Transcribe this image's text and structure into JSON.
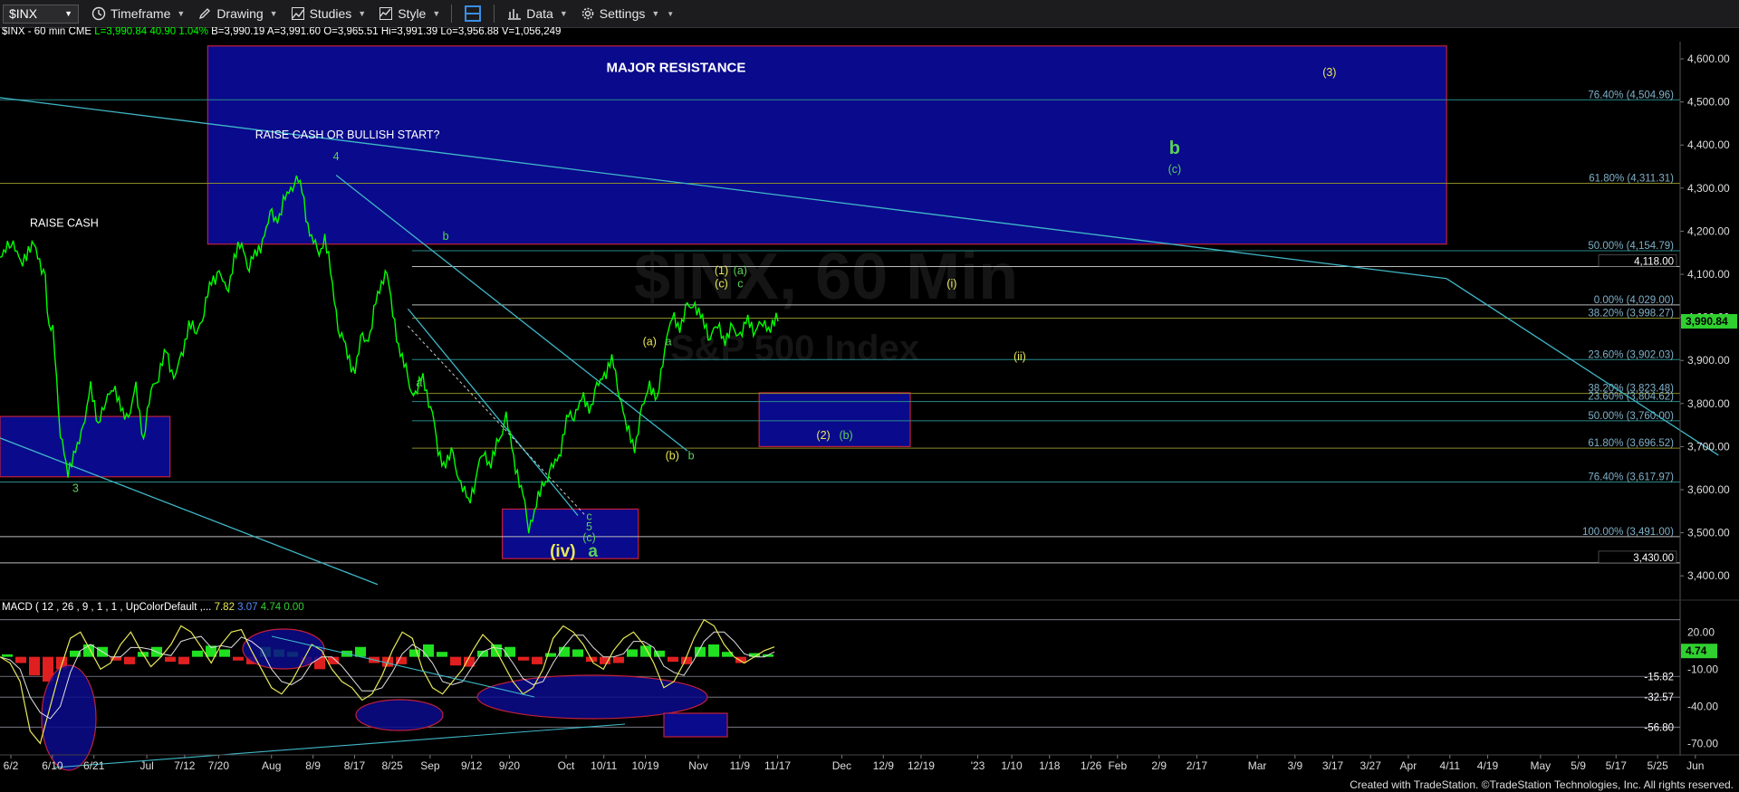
{
  "toolbar": {
    "symbol": "$INX",
    "timeframe": "Timeframe",
    "drawing": "Drawing",
    "studies": "Studies",
    "style": "Style",
    "data": "Data",
    "settings": "Settings"
  },
  "header": {
    "symbol_interval": "$INX - 60 min",
    "exchange": "CME",
    "last": "L=3,990.84",
    "change": "40.90",
    "pct": "1.04%",
    "bid": "B=3,990.19",
    "ask": "A=3,991.60",
    "open": "O=3,965.51",
    "high": "Hi=3,991.39",
    "low": "Lo=3,956.88",
    "volume": "V=1,056,249"
  },
  "watermark": {
    "line1": "$INX, 60 Min",
    "line2": "S&P 500 Index"
  },
  "footer": "Created with TradeStation. ©TradeStation Technologies, Inc. All rights reserved.",
  "colors": {
    "price": "#00ff00",
    "trend": "#3fb8c8",
    "zone": "#0a0a8c",
    "zone_border": "#c0203a",
    "wave_yellow": "#e8e85a",
    "wave_green": "#5ad05a"
  },
  "chart_data": {
    "type": "line",
    "instrument": "$INX",
    "price_axis": {
      "ylim": [
        3350,
        4640
      ],
      "ticks": [
        "4,600.00",
        "4,500.00",
        "4,400.00",
        "4,300.00",
        "4,200.00",
        "4,100.00",
        "4,000.00",
        "3,900.00",
        "3,800.00",
        "3,700.00",
        "3,600.00",
        "3,500.00",
        "3,400.00"
      ],
      "tick_values": [
        4600,
        4500,
        4400,
        4300,
        4200,
        4100,
        4000,
        3900,
        3800,
        3700,
        3600,
        3500,
        3400
      ],
      "last_price_label": "3,990.84",
      "last_price": 3990.84
    },
    "x_axis": {
      "labels": [
        "6/2",
        "6/10",
        "6/21",
        "Jul",
        "7/12",
        "7/20",
        "Aug",
        "8/9",
        "8/17",
        "8/25",
        "Sep",
        "9/12",
        "9/20",
        "Oct",
        "10/11",
        "10/19",
        "Nov",
        "11/9",
        "11/17",
        "Dec",
        "12/9",
        "12/19",
        "'23",
        "1/10",
        "1/18",
        "1/26",
        "Feb",
        "2/9",
        "2/17",
        "Mar",
        "3/9",
        "3/17",
        "3/27",
        "Apr",
        "4/11",
        "4/19",
        "May",
        "5/9",
        "5/17",
        "5/25",
        "Jun"
      ],
      "positions": [
        0,
        11,
        22,
        36,
        46,
        55,
        69,
        80,
        91,
        101,
        111,
        122,
        132,
        147,
        157,
        168,
        182,
        193,
        203,
        220,
        231,
        241,
        256,
        265,
        275,
        286,
        293,
        304,
        314,
        330,
        340,
        350,
        360,
        370,
        381,
        391,
        405,
        415,
        425,
        436,
        446
      ]
    },
    "price_series": {
      "name": "$INX",
      "x": [
        0,
        3,
        6,
        9,
        12,
        13,
        14,
        16,
        18,
        20,
        22,
        24,
        26,
        28,
        30,
        32,
        34,
        36,
        38,
        40,
        42,
        44,
        46,
        48,
        50,
        52,
        54,
        56,
        58,
        60,
        62,
        64,
        66,
        68,
        70,
        72,
        74,
        76,
        78,
        80,
        82,
        84,
        86,
        88,
        90,
        92,
        94,
        96,
        98,
        100,
        102,
        104,
        106,
        108,
        110,
        112,
        114,
        116,
        118,
        120,
        122,
        124,
        126,
        128,
        130,
        132,
        134,
        136,
        138,
        140,
        142,
        144,
        146,
        148,
        150,
        152,
        154,
        156,
        158,
        160,
        162,
        164,
        166,
        168,
        170,
        172,
        174,
        176,
        178,
        180,
        182,
        184,
        186,
        188,
        190,
        192,
        194,
        196,
        198,
        200,
        202,
        204,
        206
      ],
      "y": [
        4150,
        4165,
        4140,
        4160,
        4100,
        3960,
        3990,
        3720,
        3650,
        3680,
        3750,
        3830,
        3760,
        3800,
        3850,
        3780,
        3770,
        3830,
        3720,
        3830,
        3870,
        3920,
        3860,
        3900,
        3990,
        3960,
        4020,
        4080,
        4110,
        4050,
        4140,
        4170,
        4120,
        4150,
        4190,
        4240,
        4230,
        4290,
        4320,
        4300,
        4190,
        4150,
        4180,
        4080,
        3960,
        3920,
        3870,
        3960,
        3950,
        4060,
        4110,
        4020,
        3910,
        3860,
        3810,
        3870,
        3790,
        3700,
        3650,
        3690,
        3600,
        3580,
        3620,
        3700,
        3650,
        3720,
        3760,
        3680,
        3600,
        3520,
        3560,
        3620,
        3640,
        3680,
        3760,
        3780,
        3810,
        3790,
        3830,
        3870,
        3900,
        3830,
        3740,
        3700,
        3780,
        3850,
        3800,
        3940,
        4000,
        3980,
        4020,
        4030,
        3990,
        3960,
        3980,
        3950,
        3970,
        3960,
        3990,
        3975,
        3985,
        3980,
        3990.84
      ]
    },
    "fib_levels": [
      {
        "label": "76.40% (4,504.96)",
        "value": 4504.96
      },
      {
        "label": "61.80% (4,311.31)",
        "value": 4311.31
      },
      {
        "label": "50.00% (4,154.79)",
        "value": 4154.79
      },
      {
        "label": "4,118.00",
        "value": 4118.0
      },
      {
        "label": "0.00% (4,029.00)",
        "value": 4029.0
      },
      {
        "label": "38.20% (3,998.27)",
        "value": 3998.27
      },
      {
        "label": "23.60% (3,902.03)",
        "value": 3902.03
      },
      {
        "label": "38.20% (3,823.48)",
        "value": 3823.48
      },
      {
        "label": "23.60% (3,804.62)",
        "value": 3804.62
      },
      {
        "label": "50.00% (3,760.00)",
        "value": 3760.0
      },
      {
        "label": "61.80% (3,696.52)",
        "value": 3696.52
      },
      {
        "label": "76.40% (3,617.97)",
        "value": 3617.97
      },
      {
        "label": "100.00% (3,491.00)",
        "value": 3491.0
      },
      {
        "label": "3,430.00",
        "value": 3430.0
      }
    ],
    "zones": [
      {
        "name": "MAJOR RESISTANCE",
        "x": [
          55,
          383
        ],
        "y": [
          4170,
          4630
        ]
      },
      {
        "name": "left-support",
        "x": [
          0,
          45
        ],
        "y": [
          3630,
          3770
        ]
      },
      {
        "name": "c-target",
        "x": [
          133,
          169
        ],
        "y": [
          3440,
          3555
        ]
      },
      {
        "name": "(2)-target",
        "x": [
          201,
          241
        ],
        "y": [
          3700,
          3825
        ]
      }
    ],
    "trendlines": [
      {
        "x": [
          0,
          383
        ],
        "y": [
          4510,
          4090
        ]
      },
      {
        "x": [
          0,
          100
        ],
        "y": [
          3720,
          3380
        ]
      },
      {
        "x": [
          89,
          182
        ],
        "y": [
          4330,
          3690
        ]
      },
      {
        "x": [
          108,
          153
        ],
        "y": [
          4020,
          3540
        ]
      },
      {
        "x": [
          383,
          455
        ],
        "y": [
          4090,
          3680
        ]
      }
    ],
    "annotations": [
      {
        "text": "MAJOR RESISTANCE",
        "x": 179,
        "y": 4570
      },
      {
        "text": "RAISE CASH OR BULLISH START?",
        "x": 92,
        "y": 4415
      },
      {
        "text": "RAISE CASH",
        "x": 17,
        "y": 4210
      },
      {
        "text": "4",
        "x": 89,
        "y": 4365
      },
      {
        "text": "3",
        "x": 20,
        "y": 3595
      },
      {
        "text": "b",
        "x": 118,
        "y": 4180
      },
      {
        "text": "a",
        "x": 111,
        "y": 3840
      },
      {
        "text": "(a)",
        "x": 172,
        "y": 3935
      },
      {
        "text": "a",
        "x": 177,
        "y": 3935
      },
      {
        "text": "(b)",
        "x": 178,
        "y": 3670
      },
      {
        "text": "b",
        "x": 183,
        "y": 3670
      },
      {
        "text": "(1)",
        "x": 191,
        "y": 4100
      },
      {
        "text": "(a)",
        "x": 196,
        "y": 4100
      },
      {
        "text": "(c)",
        "x": 191,
        "y": 4070
      },
      {
        "text": "c",
        "x": 196,
        "y": 4070
      },
      {
        "text": "(i)",
        "x": 252,
        "y": 4070
      },
      {
        "text": "(ii)",
        "x": 270,
        "y": 3900
      },
      {
        "text": "(2)",
        "x": 218,
        "y": 3718
      },
      {
        "text": "(b)",
        "x": 224,
        "y": 3718
      },
      {
        "text": "(3)",
        "x": 352,
        "y": 4560
      },
      {
        "text": "b",
        "x": 311,
        "y": 4380
      },
      {
        "text": "(c)",
        "x": 311,
        "y": 4335
      },
      {
        "text": "c",
        "x": 156,
        "y": 3530
      },
      {
        "text": "5",
        "x": 156,
        "y": 3505
      },
      {
        "text": "(c)",
        "x": 156,
        "y": 3480
      },
      {
        "text": "(iv)",
        "x": 149,
        "y": 3445
      },
      {
        "text": "a",
        "x": 157,
        "y": 3445
      }
    ]
  },
  "macd": {
    "label": "MACD ( 12 , 26 , 9 , 1 , 1 , UpColorDefault ,...",
    "v1": "7.82",
    "v2": "3.07",
    "v3": "4.74",
    "v4": "0.00",
    "axis_ticks": [
      "20.00",
      "-10.00",
      "-40.00",
      "-70.00"
    ],
    "tick_values": [
      20,
      -10,
      -40,
      -70
    ],
    "ref_labels": [
      "-15.82",
      "-32.57",
      "-56.80"
    ],
    "ref_values": [
      -15.82,
      -32.57,
      -56.8
    ],
    "current_label": "4.74",
    "current_value": 4.74,
    "ylim": [
      -80,
      40
    ],
    "macd_line": [
      0,
      -5,
      -20,
      -60,
      -70,
      -40,
      -10,
      15,
      20,
      5,
      -10,
      -5,
      10,
      20,
      5,
      -8,
      0,
      10,
      25,
      20,
      8,
      -5,
      10,
      20,
      22,
      5,
      -10,
      -25,
      -30,
      -20,
      -5,
      10,
      5,
      -10,
      -20,
      -25,
      -35,
      -30,
      -15,
      5,
      20,
      15,
      -10,
      -25,
      -30,
      -20,
      -10,
      5,
      18,
      10,
      -5,
      -20,
      -30,
      -25,
      -10,
      15,
      25,
      20,
      10,
      -5,
      -10,
      5,
      15,
      20,
      10,
      -5,
      -25,
      -20,
      -5,
      15,
      30,
      25,
      10,
      0,
      -5,
      0,
      5,
      8
    ],
    "hist": [
      2,
      -5,
      -15,
      -20,
      -10,
      5,
      10,
      8,
      -3,
      -6,
      4,
      8,
      -4,
      -6,
      5,
      9,
      6,
      -3,
      -6,
      8,
      6,
      4,
      -6,
      -10,
      -6,
      5,
      8,
      -5,
      -8,
      -6,
      6,
      10,
      4,
      -7,
      -8,
      5,
      10,
      8,
      -3,
      -6,
      3,
      8,
      6,
      -4,
      -6,
      -5,
      6,
      9,
      5,
      -4,
      -6,
      8,
      10,
      4,
      -5,
      3,
      2
    ]
  }
}
